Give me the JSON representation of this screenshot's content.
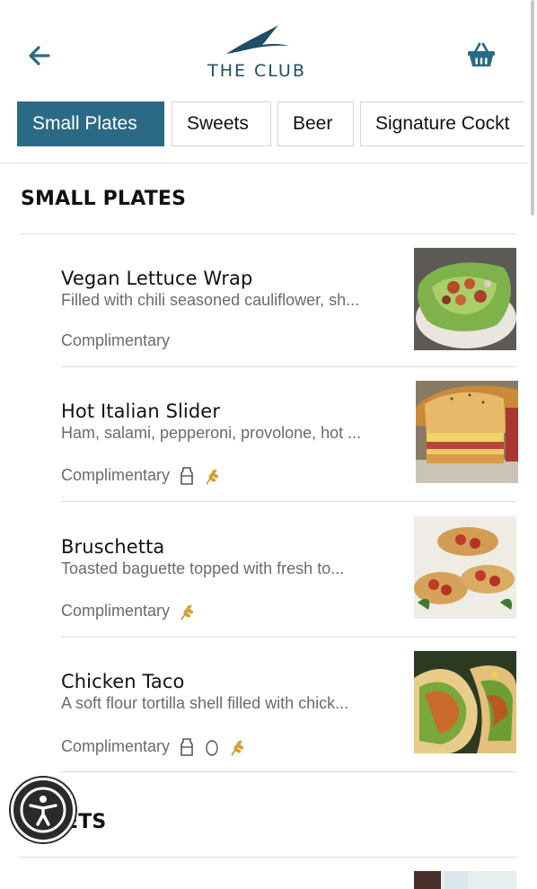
{
  "brand": {
    "name": "THE CLUB",
    "color": "#1f4e66"
  },
  "header": {
    "back_icon": "arrow-left-icon",
    "cart_icon": "basket-icon"
  },
  "tabs": [
    {
      "label": "Small Plates",
      "active": true
    },
    {
      "label": "Sweets",
      "active": false
    },
    {
      "label": "Beer",
      "active": false
    },
    {
      "label": "Signature Cockt",
      "active": false
    }
  ],
  "sections": [
    {
      "title": "SMALL PLATES",
      "items": [
        {
          "name": "Vegan Lettuce Wrap",
          "description": "Filled with chili seasoned cauliflower, sh...",
          "price": "Complimentary",
          "diet_icons": []
        },
        {
          "name": "Hot Italian Slider",
          "description": "Ham, salami, pepperoni, provolone, hot ...",
          "price": "Complimentary",
          "diet_icons": [
            "milk-icon",
            "wheat-icon"
          ]
        },
        {
          "name": "Bruschetta",
          "description": "Toasted baguette topped with fresh to...",
          "price": "Complimentary",
          "diet_icons": [
            "wheat-icon"
          ]
        },
        {
          "name": "Chicken Taco",
          "description": "A soft flour tortilla shell filled with chick...",
          "price": "Complimentary",
          "diet_icons": [
            "milk-icon",
            "egg-icon",
            "wheat-icon"
          ]
        }
      ]
    },
    {
      "title": "ETS",
      "items": []
    }
  ],
  "accessibility": {
    "icon": "accessibility-icon"
  }
}
